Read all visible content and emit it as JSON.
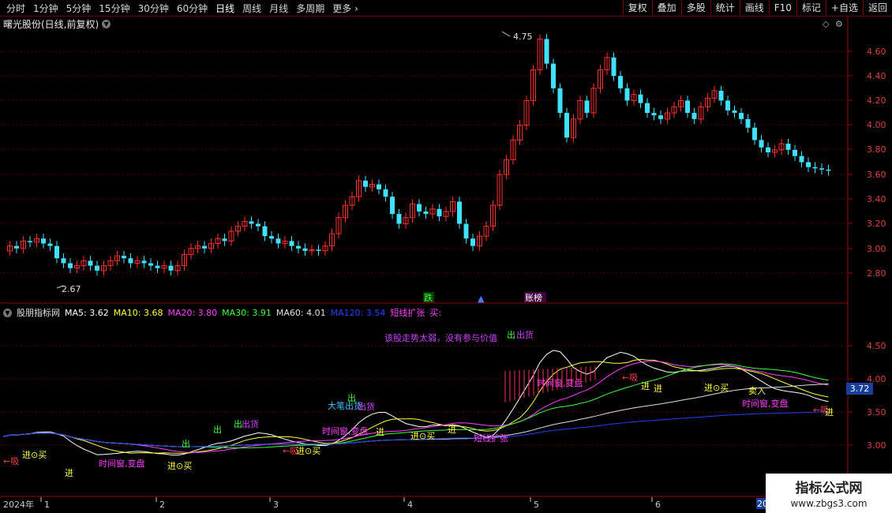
{
  "toolbar": {
    "periods": [
      "分时",
      "1分钟",
      "5分钟",
      "15分钟",
      "30分钟",
      "60分钟",
      "日线",
      "周线",
      "月线",
      "多周期",
      "更多"
    ],
    "active_period": "日线",
    "buttons": [
      "复权",
      "叠加",
      "多股",
      "统计",
      "画线",
      "F10",
      "标记",
      "+自选",
      "返回"
    ]
  },
  "upper": {
    "title": "曙光股份(日线,前复权)",
    "high_label": "4.75",
    "low_label": "2.67",
    "events": [
      "跌",
      "账榜"
    ],
    "colors": {
      "up": "#ff3030",
      "down": "#40e0ff",
      "grid": "#5a0000"
    }
  },
  "lower": {
    "indicator_name": "股朋指标网",
    "ma": [
      {
        "label": "MA5:",
        "value": "3.62",
        "color": "#ffffff"
      },
      {
        "label": "MA10:",
        "value": "3.68",
        "color": "#ffff40"
      },
      {
        "label": "MA20:",
        "value": "3.80",
        "color": "#ff40ff"
      },
      {
        "label": "MA30:",
        "value": "3.91",
        "color": "#40ff40"
      },
      {
        "label": "MA60:",
        "value": "4.01",
        "color": "#e0e0e0"
      },
      {
        "label": "MA120:",
        "value": "3.54",
        "color": "#2040ff"
      }
    ],
    "signal": "短线扩张",
    "signal_suffix": "买:",
    "current_value": "3.72",
    "notes": {
      "weak": "该股走势太弱，没有参与价值",
      "big": "大笔出货",
      "chuhuo": "出货",
      "chu": "出",
      "jin": "进",
      "buy": "进⊙买",
      "xi": "←吸",
      "window": "时间窗,变盘",
      "expand": "短线扩张",
      "maichu": "卖入"
    }
  },
  "axes": {
    "upper_ticks": [
      "4.60",
      "4.40",
      "4.20",
      "4.00",
      "3.80",
      "3.60",
      "3.40",
      "3.20",
      "3.00",
      "2.80"
    ],
    "lower_ticks": [
      "4.50",
      "4.00",
      "3.50",
      "3.00"
    ],
    "dates": [
      "2024年",
      "1",
      "2",
      "3",
      "4",
      "5",
      "6",
      "20"
    ]
  },
  "watermark": {
    "line1": "指标公式网",
    "line2": "www.zbgs3.com"
  }
}
